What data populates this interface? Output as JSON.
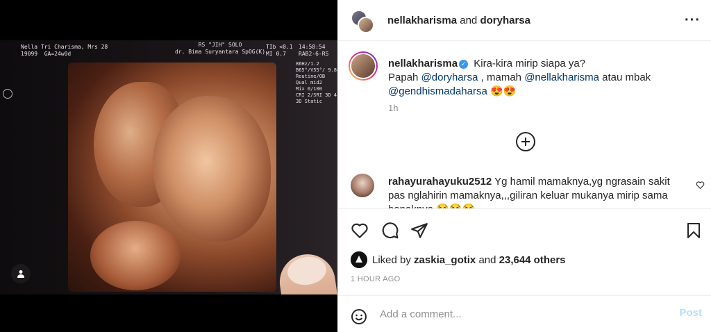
{
  "media": {
    "scan_header_left": "Nella Tri Charisma, Mrs 28\n19099  GA=24w0d",
    "scan_header_center": "RS \"JIH\" SOLO\ndr. Bima Suryantara SpOG(K)",
    "scan_header_right1": "TIb <0.1\nMI 0.7",
    "scan_header_right2": "14:58:54\nRAB2-6-RS",
    "scan_side": "86Hz/1.2\nB65°/V55°/ 9.8cm\nRoutine/OB\nQual mid2\nMix 0/100\nCRI 2/SRI 3D 4\n3D Static"
  },
  "header": {
    "user1": "nellakharisma",
    "joiner": "and",
    "user2": "doryharsa"
  },
  "caption": {
    "username": "nellakharisma",
    "line1": "Kira-kira mirip siapa ya?",
    "line2_prefix": "Papah",
    "mention1": "@doryharsa",
    "line2_mid1": ", mamah",
    "mention2": "@nellakharisma",
    "line2_mid2": "atau mbak",
    "mention3": "@gendhismadaharsa",
    "emojis": "😍😍",
    "time": "1h"
  },
  "comment": {
    "username": "rahayurahayuku2512",
    "text": "Yg hamil mamaknya,yg ngrasain sakit pas nglahirin mamaknya,,,giliran keluar mukanya mirip sama bapaknya 😂😂😂"
  },
  "likes": {
    "prefix": "Liked by",
    "liker": "zaskia_gotix",
    "joiner": "and",
    "others": "23,644 others"
  },
  "post_time": "1 HOUR AGO",
  "add_comment": {
    "placeholder": "Add a comment...",
    "post_label": "Post"
  },
  "colors": {
    "mention": "#00376b",
    "verified": "#3897f0",
    "post_disabled": "#b2dffc",
    "muted": "#8e8e8e"
  }
}
